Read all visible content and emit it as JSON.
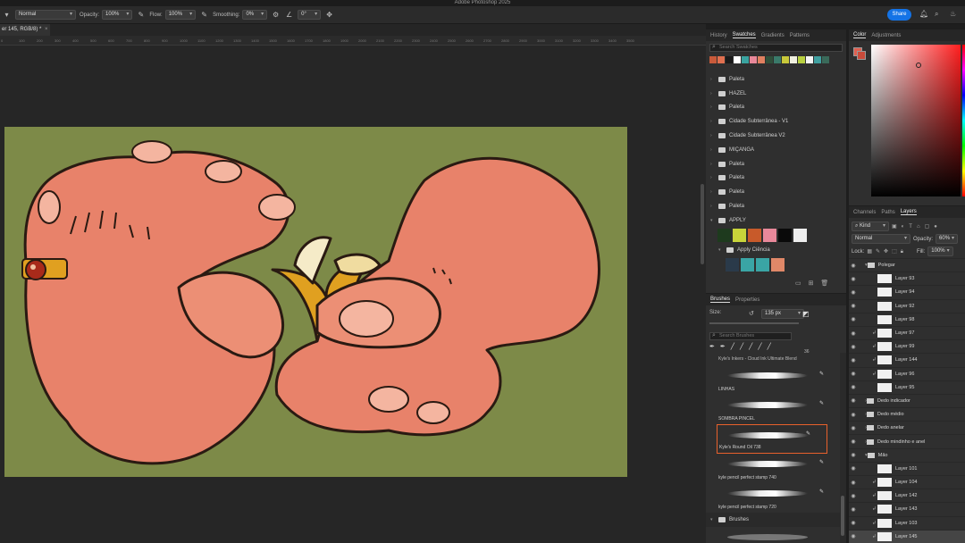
{
  "window": {
    "title": "Adobe Photoshop 2025"
  },
  "options_bar": {
    "mode": "Normal",
    "opacity_label": "Opacity:",
    "opacity_value": "100%",
    "flow_label": "Flow:",
    "flow_value": "100%",
    "smoothing_label": "Smoothing:",
    "smoothing_value": "0%",
    "angle_value": "0°",
    "share_label": "Share"
  },
  "document": {
    "tab_title": "er 145, RGB/8) *"
  },
  "ruler_ticks": [
    "0",
    "100",
    "200",
    "300",
    "400",
    "500",
    "600",
    "700",
    "800",
    "900",
    "1000",
    "1100",
    "1200",
    "1300",
    "1400",
    "1500",
    "1600",
    "1700",
    "1800",
    "1900",
    "2000",
    "2100",
    "2200",
    "2300",
    "2400",
    "2500",
    "2600",
    "2700",
    "2800",
    "2900",
    "3000",
    "3100",
    "3200",
    "3300",
    "3400",
    "3500"
  ],
  "swatches_panel": {
    "tabs": [
      "History",
      "Swatches",
      "Gradients",
      "Patterns"
    ],
    "active_tab": "Swatches",
    "search_placeholder": "Search Swatches",
    "recent_colors": [
      "#c95a3a",
      "#e07050",
      "#1a1a1a",
      "#ffffff",
      "#3aa3a0",
      "#e8889a",
      "#e08060",
      "#2f4f3a",
      "#3a7a6a",
      "#c8c83a",
      "#f0f0e0",
      "#b8d040",
      "#f5f5f5",
      "#40a0a0",
      "#3a6a5a"
    ],
    "folders": [
      {
        "name": "Paleta"
      },
      {
        "name": "HAZEL"
      },
      {
        "name": "Paleta"
      },
      {
        "name": "Cidade Subterrânea - V1"
      },
      {
        "name": "Cidade Subterrânea V2"
      },
      {
        "name": "MIÇANGA"
      },
      {
        "name": "Paleta"
      },
      {
        "name": "Paleta"
      },
      {
        "name": "Paleta"
      },
      {
        "name": "Paleta"
      },
      {
        "name": "APPLY"
      }
    ],
    "apply_colors": [
      "#1e3a1e",
      "#c8d43a",
      "#c85a2a",
      "#e8889a",
      "#0a0a0a",
      "#eeeeee"
    ],
    "subfolder": "Apply Ciência",
    "subfolder_colors": [
      "#2a3a4a",
      "#3aa5a5",
      "#3aa5a5",
      "#e08868"
    ]
  },
  "brushes_panel": {
    "tabs": [
      "Brushes",
      "Properties"
    ],
    "active_tab": "Brushes",
    "size_label": "Size:",
    "size_value": "135 px",
    "search_placeholder": "Search Brushes",
    "top_label": "Kyle's Inkers - Cloud Ink Ultimate Blend",
    "brush_size_readout": "36",
    "items": [
      {
        "name": "LINHAS"
      },
      {
        "name": "SOMBRA PINCEL"
      },
      {
        "name": "Kyle's Round Oil 738",
        "selected": true
      },
      {
        "name": "kyle pencil perfect stamp 740"
      },
      {
        "name": "kyle pencil perfect stamp 720"
      }
    ],
    "group": "Brushes",
    "last_item": "SOMBRA GRAIN"
  },
  "color_panel": {
    "tabs": [
      "Color",
      "Adjustments"
    ],
    "active_tab": "Color",
    "foreground": "#e06050",
    "background": "#c84a3a"
  },
  "layers_panel": {
    "tabs": [
      "Channels",
      "Paths",
      "Layers"
    ],
    "active_tab": "Layers",
    "filter": "Kind",
    "blend_mode": "Normal",
    "opacity_label": "Opacity:",
    "opacity_value": "60%",
    "lock_label": "Lock:",
    "fill_label": "Fill:",
    "fill_value": "100%",
    "rows": [
      {
        "name": "Polegar",
        "type": "group",
        "indent": 1
      },
      {
        "name": "Layer 93",
        "type": "layer",
        "indent": 2
      },
      {
        "name": "Layer 94",
        "type": "layer",
        "indent": 2
      },
      {
        "name": "Layer 92",
        "type": "layer",
        "indent": 2
      },
      {
        "name": "Layer 98",
        "type": "layer",
        "indent": 2
      },
      {
        "name": "Layer 97",
        "type": "layer",
        "indent": 2,
        "clip": true
      },
      {
        "name": "Layer 99",
        "type": "layer",
        "indent": 2,
        "clip": true
      },
      {
        "name": "Layer 144",
        "type": "layer",
        "indent": 2,
        "clip": true
      },
      {
        "name": "Layer 96",
        "type": "layer",
        "indent": 2,
        "clip": true
      },
      {
        "name": "Layer 95",
        "type": "layer",
        "indent": 2
      },
      {
        "name": "Dedo indicador",
        "type": "group",
        "indent": 1
      },
      {
        "name": "Dedo médio",
        "type": "group",
        "indent": 1
      },
      {
        "name": "Dedo anelar",
        "type": "group",
        "indent": 1
      },
      {
        "name": "Dedo mindinho e anel",
        "type": "group",
        "indent": 1
      },
      {
        "name": "Mão",
        "type": "group",
        "indent": 1
      },
      {
        "name": "Layer 101",
        "type": "layer",
        "indent": 2
      },
      {
        "name": "Layer 104",
        "type": "layer",
        "indent": 2,
        "clip": true
      },
      {
        "name": "Layer 142",
        "type": "layer",
        "indent": 2,
        "clip": true
      },
      {
        "name": "Layer 143",
        "type": "layer",
        "indent": 2,
        "clip": true
      },
      {
        "name": "Layer 103",
        "type": "layer",
        "indent": 2,
        "clip": true
      },
      {
        "name": "Layer 145",
        "type": "layer",
        "indent": 2,
        "clip": true,
        "selected": true
      }
    ]
  }
}
